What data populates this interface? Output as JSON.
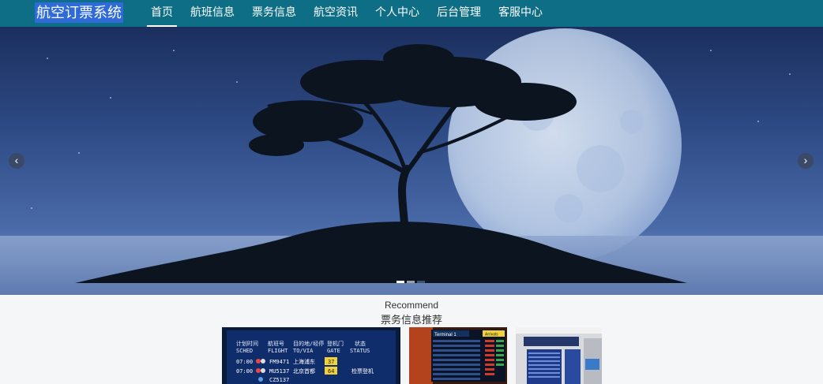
{
  "header": {
    "logo": "航空订票系统",
    "nav": [
      "首页",
      "航班信息",
      "票务信息",
      "航空资讯",
      "个人中心",
      "后台管理",
      "客服中心"
    ],
    "active_index": 0
  },
  "carousel": {
    "prev_icon": "chevron-left-icon",
    "next_icon": "chevron-right-icon",
    "prev_glyph": "‹",
    "next_glyph": "›",
    "indicator_count": 3,
    "active_indicator": 0
  },
  "recommend": {
    "title_en": "Recommend",
    "title_cn": "票务信息推荐",
    "cards": [
      {
        "type": "departure-board",
        "header_cn": [
          "计划时间",
          "航班号",
          "目的地/经停",
          "登机门",
          "状态"
        ],
        "header_en": [
          "SCHED",
          "FLIGHT",
          "TO/VIA",
          "GATE",
          "STATUS"
        ],
        "rows": [
          {
            "time": "07:00",
            "flight": "FM9471",
            "dest": "上海浦东",
            "gate": "37",
            "status": ""
          },
          {
            "time": "07:00",
            "flight": "MU5137",
            "dest": "北京首都",
            "gate": "64",
            "status": "检票登机"
          },
          {
            "time": "",
            "flight": "CZ5137",
            "dest": "",
            "gate": "",
            "status": ""
          }
        ]
      },
      {
        "type": "terminal-board",
        "title": "Terminal 1",
        "tag": "Arrivals"
      },
      {
        "type": "airport-photo"
      }
    ]
  }
}
